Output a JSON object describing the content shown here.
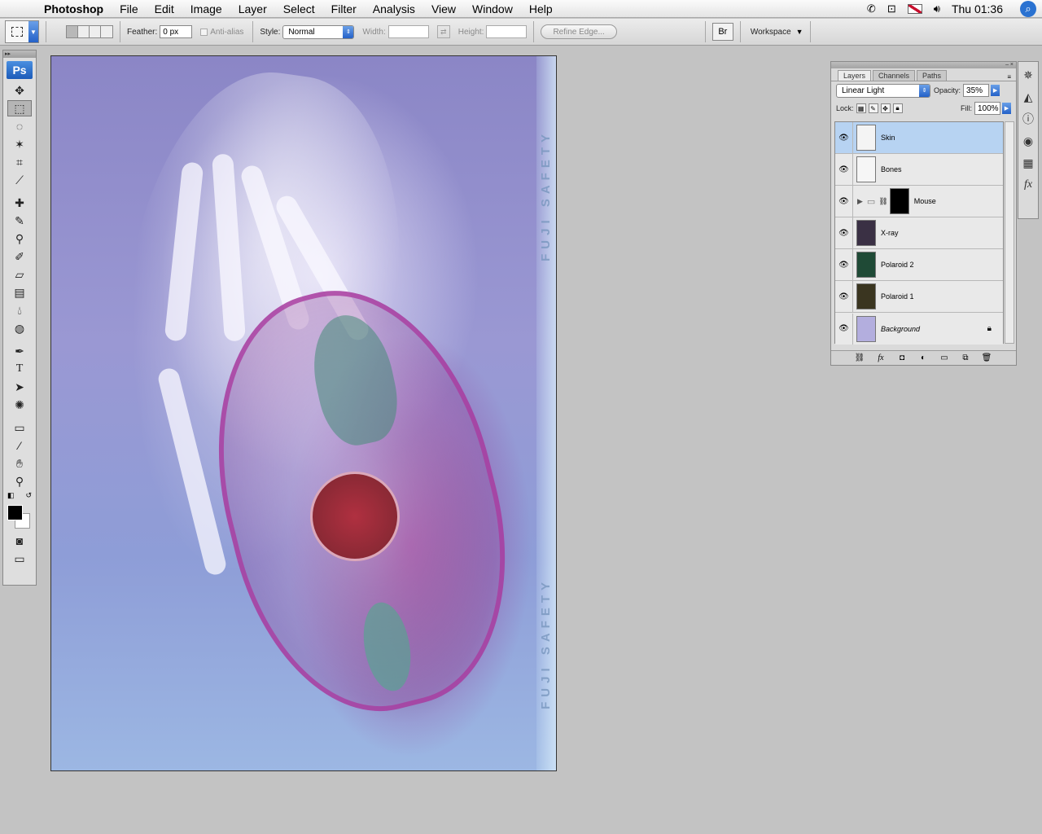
{
  "menubar": {
    "apple": "",
    "app": "Photoshop",
    "items": [
      "File",
      "Edit",
      "Image",
      "Layer",
      "Select",
      "Filter",
      "Analysis",
      "View",
      "Window",
      "Help"
    ],
    "clock": "Thu 01:36"
  },
  "options": {
    "feather_label": "Feather:",
    "feather_value": "0 px",
    "antialias_label": "Anti-alias",
    "style_label": "Style:",
    "style_value": "Normal",
    "width_label": "Width:",
    "height_label": "Height:",
    "refine_edge": "Refine Edge...",
    "workspace": "Workspace"
  },
  "tools": {
    "logo": "Ps"
  },
  "document": {
    "watermark": "FUJI SAFETY"
  },
  "layers_panel": {
    "tabs": [
      "Layers",
      "Channels",
      "Paths"
    ],
    "blend_mode": "Linear Light",
    "opacity_label": "Opacity:",
    "opacity_value": "35%",
    "lock_label": "Lock:",
    "fill_label": "Fill:",
    "fill_value": "100%",
    "layers": [
      {
        "name": "Skin",
        "selected": true,
        "thumb_color": "#f4f4f4"
      },
      {
        "name": "Bones",
        "selected": false,
        "thumb_color": "#f6f6f6"
      },
      {
        "name": "Mouse",
        "selected": false,
        "thumb_color": "#000000",
        "group": true
      },
      {
        "name": "X-ray",
        "selected": false,
        "thumb_color": "#3a3044"
      },
      {
        "name": "Polaroid 2",
        "selected": false,
        "thumb_color": "#1f4a36"
      },
      {
        "name": "Polaroid 1",
        "selected": false,
        "thumb_color": "#3a3520"
      },
      {
        "name": "Background",
        "selected": false,
        "thumb_color": "#b3aede",
        "locked": true
      }
    ]
  }
}
